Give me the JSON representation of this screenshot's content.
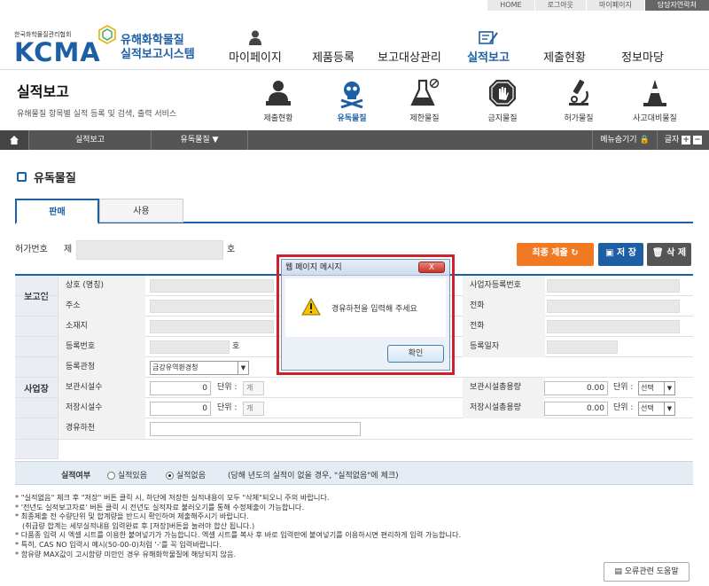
{
  "util_nav": [
    "HOME",
    "로그아웃",
    "마이페이지",
    "담당자연락처"
  ],
  "logo": {
    "org": "한국화학물질관리협회",
    "abbr": "KCMA",
    "title_line1": "유해화학물질",
    "title_line2": "실적보고시스템"
  },
  "gnb": [
    "마이페이지",
    "제품등록",
    "보고대상관리",
    "실적보고",
    "제출현황",
    "정보마당"
  ],
  "page": {
    "title": "실적보고",
    "description": "유해물질 항목별 실적 등록 및 검색, 출력 서비스"
  },
  "subnav": [
    {
      "label": "제출현황",
      "icon": "person-desk-icon"
    },
    {
      "label": "유독물질",
      "icon": "skull-crossbones-icon",
      "active": true
    },
    {
      "label": "제한물질",
      "icon": "flask-no-icon"
    },
    {
      "label": "금지물질",
      "icon": "prohibited-hand-icon"
    },
    {
      "label": "허가물질",
      "icon": "microscope-icon"
    },
    {
      "label": "사고대비물질",
      "icon": "traffic-cone-icon"
    }
  ],
  "navbar": {
    "crumb1": "실적보고",
    "crumb2": "유독물질 ▼",
    "hide_menu": "메뉴숨기기",
    "font": "글자"
  },
  "section_title": "유독물질",
  "tabs": [
    "판매",
    "사용"
  ],
  "permit": {
    "label": "허가번호",
    "prefix": "제",
    "suffix": "호"
  },
  "buttons": {
    "final_submit": "최종 제출",
    "save": "저 장",
    "delete": "삭 제",
    "help": "오류관련 도움말"
  },
  "reporter": {
    "group": "보고인",
    "name_label": "상호 (명칭)",
    "address_label": "주소",
    "biz_no_label": "사업자등록번호",
    "phone_label": "전화"
  },
  "workplace": {
    "group": "사업장",
    "location_label": "소재지",
    "reg_no_label": "등록번호",
    "reg_no_suffix": "호",
    "authority_label": "등록관청",
    "authority_value": "금강유역환경청",
    "storage_count_label": "보관시설수",
    "storage_count_value": "0",
    "warehouse_count_label": "저장시설수",
    "warehouse_count_value": "0",
    "unit_label": "단위 :",
    "unit_value": "개",
    "storage_cap_label": "보관시설총용량",
    "storage_cap_value": "0.00",
    "warehouse_cap_label": "저장시설총용량",
    "warehouse_cap_value": "0.00",
    "select_placeholder": "선택",
    "phone_label": "전화",
    "reg_date_label": "등록일자",
    "route_label": "경유하천"
  },
  "performance": {
    "label": "실적여부",
    "opt_yes": "실적있음",
    "opt_no": "실적없음",
    "note": "(당해 년도의 실적이 없을 경우, \"실적없음\"에 체크)"
  },
  "notes": [
    "* \"실적없음\" 체크 후 \"저장\" 버튼 클릭 시, 하단에 저장한 실적내용이 모두 \"삭제\"되오니 주의 바랍니다.",
    "* '전년도 실적보고자료' 버튼 클릭 시 전년도 실적자료 불러오기를 통해 수정제출이 가능합니다.",
    "* 최종제출 전 수량단위 및 합계량을 반드시 확인하여 제출해주시기 바랍니다.",
    "  (취급량 합계는 세부실적내용 입력완료 후 [저장]버튼을 눌러야 합산 됩니다.)",
    "* 다품종 입력 시 엑셀 시트를 이용한 붙여넣기가 가능합니다. 엑셀 시트를 복사 후 바로 입력란에 붙여넣기를 이용하시면 편리하게 입력 가능합니다.",
    "* 특히, CAS NO 입력시 예시(50-00-0)처럼 '-'를 꼭 입력바랍니다.",
    "* 함유량 MAX값이 고시함량 미만인 경우 유해화학물질에 해당되지 않음."
  ],
  "dialog": {
    "title": "웹 페이지 메시지",
    "message": "경유하천을 입력해 주세요",
    "ok": "확인",
    "close": "X"
  },
  "colors": {
    "brand": "#1d5fa5",
    "submit": "#f07921",
    "save": "#1d5fa5",
    "delete": "#555555",
    "alert": "#d0202a"
  }
}
